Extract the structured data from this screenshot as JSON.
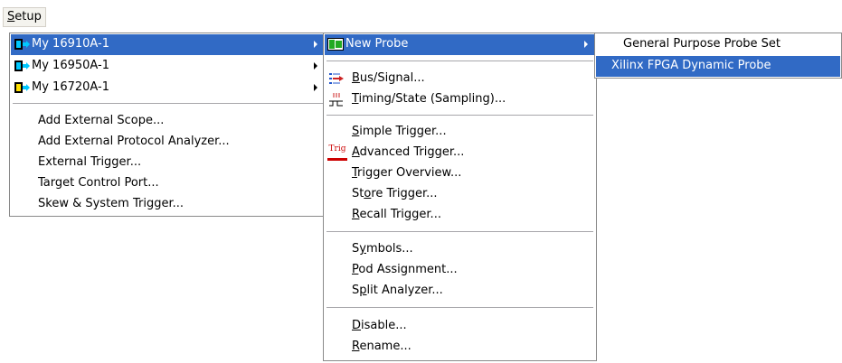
{
  "menubar": {
    "setup_label": "Setup"
  },
  "main_menu": {
    "items": [
      {
        "label": "My 16910A-1",
        "selected": true,
        "submenu": true,
        "icon": "analyzer-cyan-icon"
      },
      {
        "label": "My 16950A-1",
        "selected": false,
        "submenu": true,
        "icon": "analyzer-cyan-icon"
      },
      {
        "label": "My 16720A-1",
        "selected": false,
        "submenu": true,
        "icon": "analyzer-yellow-icon"
      }
    ],
    "commands": [
      "Add External Scope...",
      "Add External Protocol Analyzer...",
      "External Trigger...",
      "Target Control Port...",
      "Skew & System Trigger..."
    ]
  },
  "probe_menu": {
    "new_probe": "New Probe",
    "bus_signal": {
      "accel": "B",
      "rest": "us/Signal..."
    },
    "timing_state": {
      "accel": "T",
      "rest": "iming/State (Sampling)..."
    },
    "simple_trigger": {
      "accel": "S",
      "rest": "imple Trigger..."
    },
    "advanced_trigger": {
      "accel": "A",
      "rest": "dvanced Trigger..."
    },
    "trigger_overview": {
      "accel": "T",
      "rest": "rigger Overview..."
    },
    "store_trigger": {
      "pre": "St",
      "accel": "o",
      "rest": "re Trigger..."
    },
    "recall_trigger": {
      "accel": "R",
      "rest": "ecall Trigger..."
    },
    "symbols": {
      "pre": "S",
      "accel": "y",
      "rest": "mbols..."
    },
    "pod_assignment": {
      "accel": "P",
      "rest": "od Assignment..."
    },
    "split_analyzer": {
      "pre": "S",
      "accel": "p",
      "rest": "lit Analyzer..."
    },
    "disable": {
      "accel": "D",
      "rest": "isable..."
    },
    "rename": {
      "accel": "R",
      "rest": "ename..."
    },
    "trig_icon_text": "Trig"
  },
  "probeset_menu": {
    "items": [
      "General Purpose Probe Set",
      "Xilinx FPGA Dynamic Probe"
    ]
  },
  "colors": {
    "selection": "#316ac5",
    "menu_border": "#8a8a8a",
    "cyan_icon": "#00c8ff",
    "yellow_icon": "#ffe000",
    "probe_green": "#22aa22"
  }
}
